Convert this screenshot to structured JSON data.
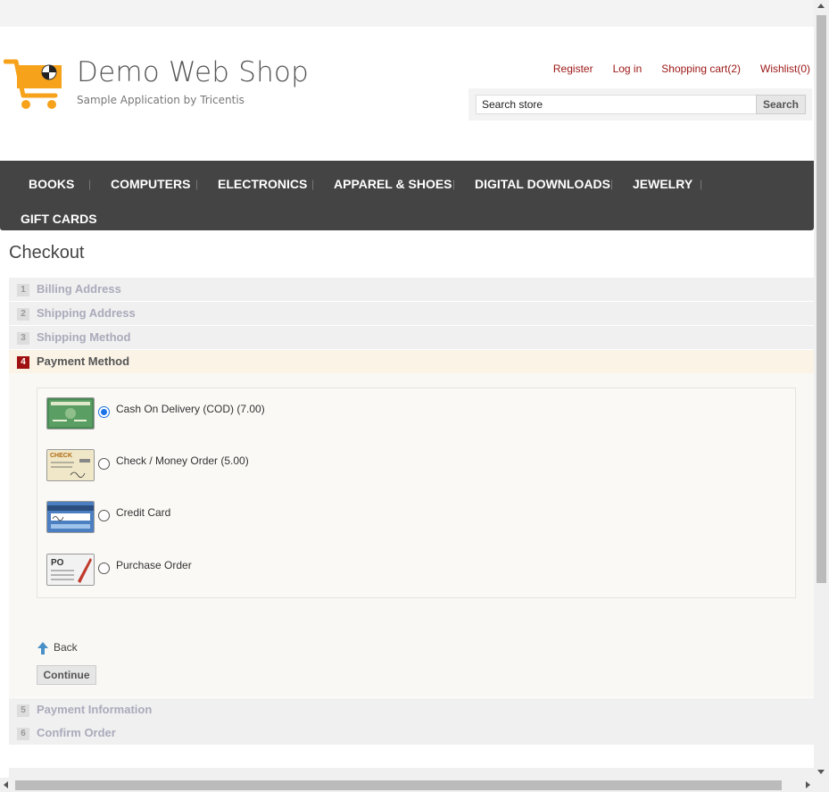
{
  "header": {
    "title": "Demo Web Shop",
    "subtitle": "Sample Application by Tricentis",
    "links": {
      "register": "Register",
      "login": "Log in",
      "cart": "Shopping cart(2)",
      "wishlist": "Wishlist(0)"
    },
    "search": {
      "value": "Search store",
      "button": "Search"
    }
  },
  "menu": [
    "BOOKS",
    "COMPUTERS",
    "ELECTRONICS",
    "APPAREL & SHOES",
    "DIGITAL DOWNLOADS",
    "JEWELRY",
    "GIFT CARDS"
  ],
  "checkout": {
    "title": "Checkout",
    "steps": [
      {
        "num": "1",
        "label": "Billing Address"
      },
      {
        "num": "2",
        "label": "Shipping Address"
      },
      {
        "num": "3",
        "label": "Shipping Method"
      },
      {
        "num": "4",
        "label": "Payment Method"
      },
      {
        "num": "5",
        "label": "Payment Information"
      },
      {
        "num": "6",
        "label": "Confirm Order"
      }
    ],
    "active_step": 4,
    "payment_methods": [
      {
        "label": "Cash On Delivery (COD) (7.00)",
        "icon": "credit-card-green-icon",
        "selected": true
      },
      {
        "label": "Check / Money Order (5.00)",
        "icon": "check-icon",
        "selected": false
      },
      {
        "label": "Credit Card",
        "icon": "credit-card-icon",
        "selected": false
      },
      {
        "label": "Purchase Order",
        "icon": "purchase-order-icon",
        "selected": false
      }
    ],
    "back_label": "Back",
    "continue_label": "Continue"
  },
  "colors": {
    "link": "#9c1616",
    "menu_bg": "#444444",
    "accent": "#a01010",
    "radio_selected": "#1a73e8"
  }
}
